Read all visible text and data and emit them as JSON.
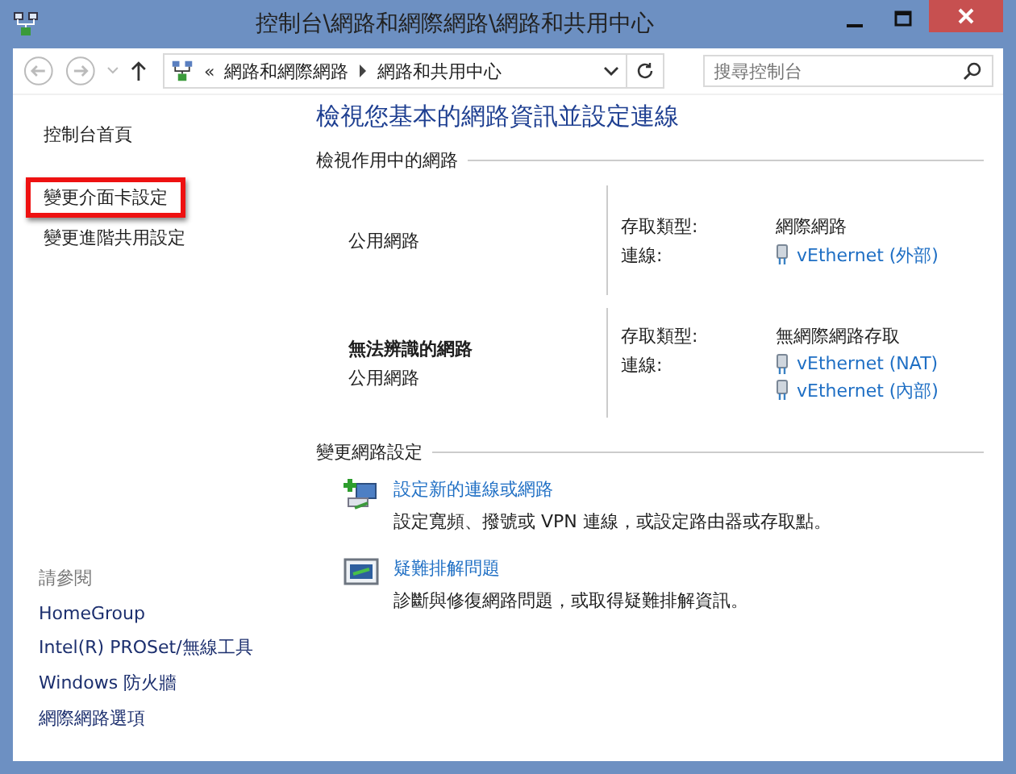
{
  "window": {
    "title": "控制台\\網路和網際網路\\網路和共用中心"
  },
  "nav": {
    "breadcrumb": [
      {
        "label": "網路和網際網路"
      },
      {
        "label": "網路和共用中心"
      }
    ],
    "overflow": "«",
    "search": {
      "placeholder": "搜尋控制台"
    }
  },
  "sidebar": {
    "items": [
      {
        "label": "控制台首頁",
        "highlighted": false
      },
      {
        "label": "變更介面卡設定",
        "highlighted": true
      },
      {
        "label": "變更進階共用設定",
        "highlighted": false
      }
    ],
    "see_also": {
      "heading": "請參閱",
      "links": [
        "HomeGroup",
        "Intel(R) PROSet/無線工具",
        "Windows 防火牆",
        "網際網路選項"
      ]
    }
  },
  "main": {
    "title": "檢視您基本的網路資訊並設定連線",
    "active_networks": {
      "heading": "檢視作用中的網路",
      "networks": [
        {
          "category": "公用網路",
          "access_label": "存取類型:",
          "access_value": "網際網路",
          "connections_label": "連線:",
          "connections": [
            "vEthernet (外部)"
          ]
        },
        {
          "name": "無法辨識的網路",
          "category": "公用網路",
          "access_label": "存取類型:",
          "access_value": "無網際網路存取",
          "connections_label": "連線:",
          "connections": [
            "vEthernet (NAT)",
            "vEthernet (內部)"
          ]
        }
      ]
    },
    "change_settings": {
      "heading": "變更網路設定",
      "tasks": [
        {
          "kind": "new-connection",
          "link": "設定新的連線或網路",
          "description": "設定寬頻、撥號或 VPN 連線，或設定路由器或存取點。"
        },
        {
          "kind": "troubleshoot",
          "link": "疑難排解問題",
          "description": "診斷與修復網路問題，或取得疑難排解資訊。"
        }
      ]
    }
  }
}
